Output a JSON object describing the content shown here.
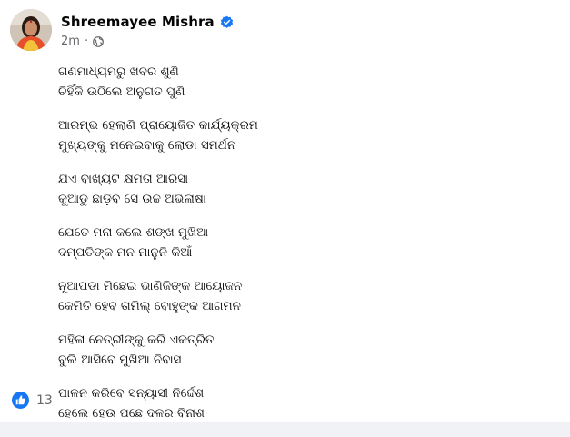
{
  "post": {
    "author": "Shreemayee Mishra",
    "timestamp": "2m",
    "separator": "·",
    "icons": {
      "verified": "verified-badge-icon",
      "audience": "globe-icon",
      "reaction": "like-icon"
    },
    "colors": {
      "verified": "#1877f2",
      "like": "#1877f2",
      "text": "#050505",
      "secondary": "#65676b"
    },
    "stanzas": [
      [
        "ଗଣମାଧ୍ୟମରୁ ଖବର ଶୁଣି",
        "ଚିହିଁକି ଉଠିଲେ ଅନୁଗତ ପୁଣି"
      ],
      [
        "ଆରମ୍ଭ ହେଲାଣି ପ୍ରାୟୋଜିତ କାର୍ଯ୍ୟକ୍ରମ",
        "ମୁଖ୍ୟଙ୍କୁ ମନେଇବାକୁ ଲୋଡା ସମର୍ଥନ"
      ],
      [
        "ଯିଏ ବାଖ୍ୟଟି କ୍ଷମତା ଆରିସା",
        "କୁଆଡୁ ଛାଡ଼ିବ ସେ ଉଚ୍ଚ ଅଭିଳାଷା"
      ],
      [
        "ଯେତେ ମନା କଲେ ଶଙ୍ଖ ମୁଖିଆ",
        "ଦମ୍ପତିଙ୍କ ମନ ମାନୁନି କିଆଁ"
      ],
      [
        "ନୂଆପଡା ମିଛେଇ ଭାଣିଜିଙ୍କ ଆୟୋଜନ",
        "କେମିତି ହେବ ତାମିଲ୍ ବୋହୁଙ୍କ ଆଗମନ"
      ],
      [
        "ମହିଳା ନେତ୍ରୀଙ୍କୁ କରି ଏକତ୍ରିତ",
        "ବୁଲି ଆସିବେ ମୁଖିଆ ନିବାସ"
      ],
      [
        "ପାଳନ କରିବେ ସନ୍ୟାସୀ  ନିର୍ଦ୍ଦେଶ",
        "ହେଲେ ହେଉ ପଛେ ଦଳର ବିନାଶ"
      ]
    ],
    "reaction_count": "13"
  }
}
